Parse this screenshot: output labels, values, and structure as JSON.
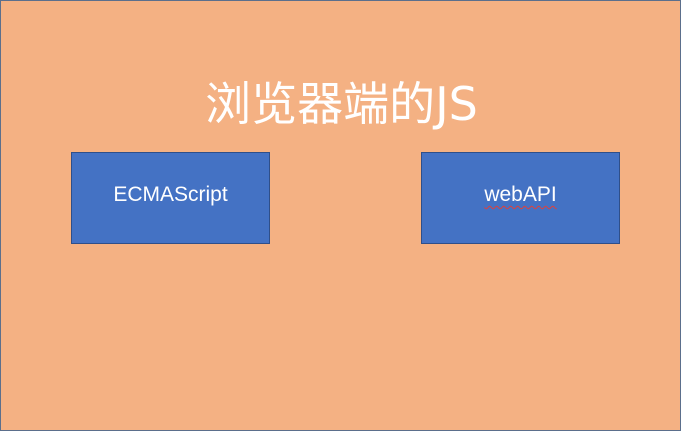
{
  "slide": {
    "title": "浏览器端的JS",
    "boxes": [
      {
        "label": "ECMAScript"
      },
      {
        "label": "webAPI"
      }
    ],
    "colors": {
      "background": "#f4b183",
      "box": "#4472c4",
      "text": "#ffffff",
      "spellcheck_underline": "#e0403a"
    }
  }
}
